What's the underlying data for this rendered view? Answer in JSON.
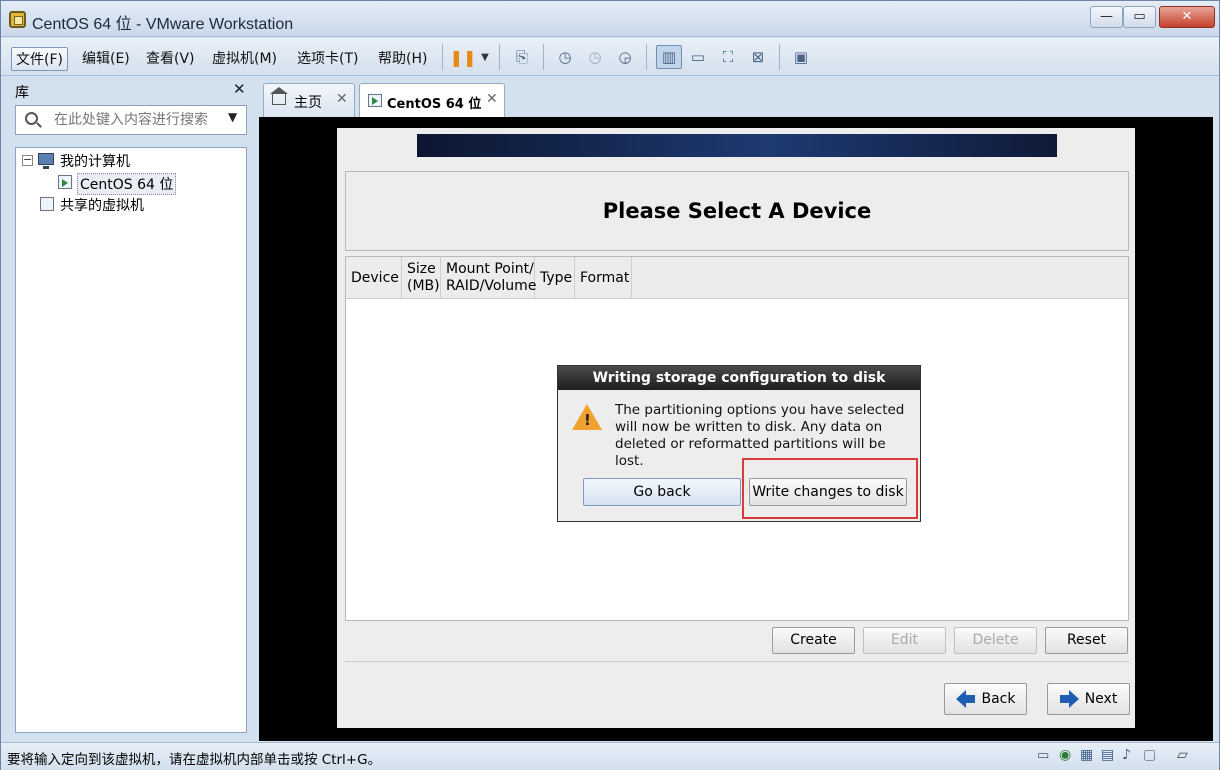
{
  "window": {
    "title": "CentOS 64 位 - VMware Workstation"
  },
  "menu": [
    "文件(F)",
    "编辑(E)",
    "查看(V)",
    "虚拟机(M)",
    "选项卡(T)",
    "帮助(H)"
  ],
  "library": {
    "title": "库",
    "close": "✕",
    "search_placeholder": "在此处键入内容进行搜索",
    "tree": {
      "root": "我的计算机",
      "vm": "CentOS 64 位",
      "shared": "共享的虚拟机"
    }
  },
  "tabs": [
    {
      "label": "主页",
      "close": "✕"
    },
    {
      "label": "CentOS 64 位",
      "close": "✕"
    }
  ],
  "installer": {
    "page_title": "Please Select A Device",
    "columns": [
      "Device",
      "Size\n(MB)",
      "Mount Point/\nRAID/Volume",
      "Type",
      "Format"
    ],
    "buttons": {
      "create": "Create",
      "edit": "Edit",
      "delete": "Delete",
      "reset": "Reset"
    },
    "nav": {
      "back": "Back",
      "next": "Next"
    }
  },
  "dialog": {
    "title": "Writing storage configuration to disk",
    "warning_mark": "!",
    "message": "The partitioning options you have selected\nwill now be written to disk.  Any data on\ndeleted or reformatted partitions will be lost.",
    "go_back": "Go back",
    "write": "Write changes to disk"
  },
  "statusbar": {
    "text": "要将输入定向到该虚拟机，请在虚拟机内部单击或按 Ctrl+G。"
  },
  "colors": {
    "accent": "#1f5fb3",
    "highlight": "#d93a3a",
    "warning": "#f0a12e"
  }
}
